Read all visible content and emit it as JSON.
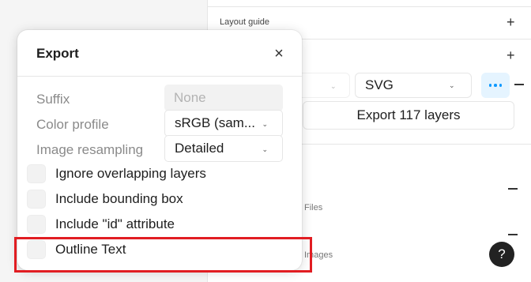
{
  "panel": {
    "layout_guide_label": "Layout guide",
    "export_format": "SVG",
    "export_button_label": "Export 117 layers",
    "files_label": "Files",
    "images_label": "Images",
    "help_label": "?"
  },
  "export_modal": {
    "title": "Export",
    "rows": {
      "suffix_label": "Suffix",
      "suffix_placeholder": "None",
      "color_profile_label": "Color profile",
      "color_profile_value": "sRGB (sam...",
      "image_resampling_label": "Image resampling",
      "image_resampling_value": "Detailed"
    },
    "options": [
      {
        "label": "Ignore overlapping layers",
        "checked": false
      },
      {
        "label": "Include bounding box",
        "checked": false
      },
      {
        "label": "Include \"id\" attribute",
        "checked": false
      },
      {
        "label": "Outline Text",
        "checked": false
      }
    ]
  },
  "colors": {
    "accent": "#0d99ff",
    "highlight": "#e11d22"
  }
}
